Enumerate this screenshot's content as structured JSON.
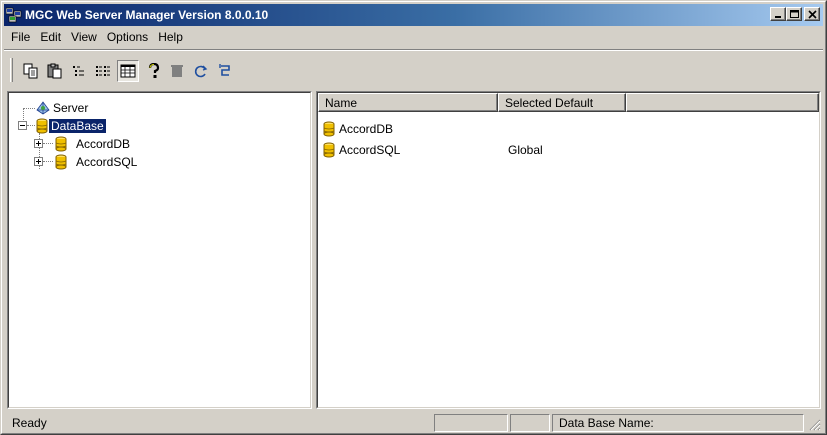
{
  "window": {
    "title": "MGC Web Server Manager Version 8.0.0.10",
    "title_bar_color": "#0a246a",
    "controls": [
      "minimize-icon",
      "maximize-icon",
      "close-icon"
    ]
  },
  "menu": {
    "items": [
      {
        "label": "File"
      },
      {
        "label": "Edit"
      },
      {
        "label": "View"
      },
      {
        "label": "Options"
      },
      {
        "label": "Help"
      }
    ]
  },
  "toolbar": {
    "buttons": [
      {
        "icon": "copy-icon"
      },
      {
        "icon": "paste-icon"
      },
      {
        "icon": "list-icon"
      },
      {
        "icon": "details-icon"
      },
      {
        "icon": "grid-view-icon",
        "pressed": true
      },
      {
        "icon": "help-icon"
      },
      {
        "icon": "delete-icon"
      },
      {
        "icon": "refresh-icon"
      },
      {
        "icon": "undo-icon"
      }
    ]
  },
  "tree": {
    "nodes": [
      {
        "label": "Server",
        "icon": "server-icon"
      },
      {
        "label": "DataBase",
        "icon": "database-icon",
        "selected": true,
        "expanded": true
      },
      {
        "label": "AccordDB",
        "icon": "database-icon"
      },
      {
        "label": "AccordSQL",
        "icon": "database-icon"
      }
    ]
  },
  "list": {
    "columns": [
      "Name",
      "Selected Default"
    ],
    "rows": [
      {
        "name": "AccordDB",
        "default": ""
      },
      {
        "name": "AccordSQL",
        "default": "Global"
      }
    ]
  },
  "status": {
    "text": "Ready",
    "database_label": "Data Base Name:"
  }
}
